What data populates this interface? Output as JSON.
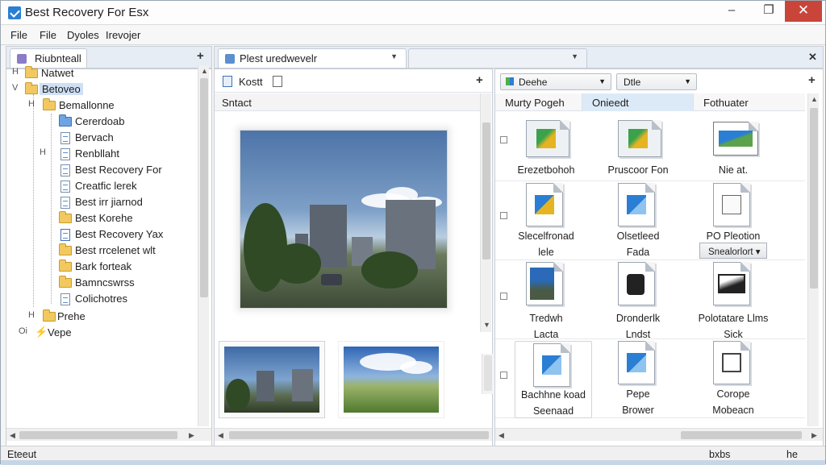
{
  "window": {
    "title": "Best Recovery For Esx",
    "minimize": "–",
    "maximize": "❐",
    "close": "✕"
  },
  "menu": [
    "File",
    "File",
    "Dyoles",
    "Irevojer"
  ],
  "left_tab": {
    "label": "Riubnteall",
    "plus": "+"
  },
  "tree": [
    {
      "label": "Natwet",
      "expander": "H"
    },
    {
      "label": "Betoveo",
      "expander": "V"
    },
    {
      "label": "Bemallonne",
      "expander": "H"
    },
    {
      "label": "Cererdoab"
    },
    {
      "label": "Bervach"
    },
    {
      "label": "Renbllaht",
      "expander": "H"
    },
    {
      "label": "Best Recovery For"
    },
    {
      "label": "Creatfic lerek"
    },
    {
      "label": "Best irr jiarnod"
    },
    {
      "label": "Best Korehe"
    },
    {
      "label": "Best Recovery Yax"
    },
    {
      "label": "Best rrcelenet wlt"
    },
    {
      "label": "Bark forteak"
    },
    {
      "label": "Bamncswrss"
    },
    {
      "label": "Colichotres"
    },
    {
      "label": "Prehe",
      "expander": "H"
    },
    {
      "label": "Vepe",
      "expander": "Oi"
    }
  ],
  "mid_tab": {
    "label": "Plest uredwevelr",
    "plus": "+"
  },
  "mid_toolbar": {
    "button": "Kostt",
    "plus": "+"
  },
  "mid_header": "Sntact",
  "right_toolbar": {
    "combo1": "Deehe",
    "combo2": "Dtle",
    "plus": "+"
  },
  "right_close": "✕",
  "columns": [
    "Murty Pogeh",
    "Onieedt",
    "Fothuater"
  ],
  "files": [
    [
      {
        "name": "Erezetbohoh",
        "name2": "",
        "icon": "shared-cube-icon"
      },
      {
        "name": "Pruscoor Fon",
        "name2": "",
        "icon": "shared-cube-icon"
      },
      {
        "name": "Nie at.",
        "name2": "",
        "icon": "landscape-image-icon"
      }
    ],
    [
      {
        "name": "Slecelfronad",
        "name2": "lele",
        "icon": "media-document-icon"
      },
      {
        "name": "Olsetleed",
        "name2": "Fada",
        "icon": "media-document-icon"
      },
      {
        "name": "PO Pleotion",
        "name2": "",
        "icon": "plugin-document-icon"
      }
    ],
    [
      {
        "name": "Tredwh",
        "name2": "Lacta",
        "icon": "photo-document-icon"
      },
      {
        "name": "Dronderlk",
        "name2": "Lndst",
        "icon": "device-document-icon"
      },
      {
        "name": "Polotatare Llms",
        "name2": "Sick",
        "icon": "image-frame-icon"
      }
    ],
    [
      {
        "name": "Bachhne koad",
        "name2": "Seenaad",
        "icon": "media-document-icon"
      },
      {
        "name": "Pepe",
        "name2": "Brower",
        "icon": "media-document-icon"
      },
      {
        "name": "Corope",
        "name2": "Mobeacn",
        "icon": "plugin-document-icon"
      }
    ]
  ],
  "select_button": "Snealorlort ▾",
  "status": {
    "left": "Eteeut",
    "mid": "bxbs",
    "right": "he"
  }
}
